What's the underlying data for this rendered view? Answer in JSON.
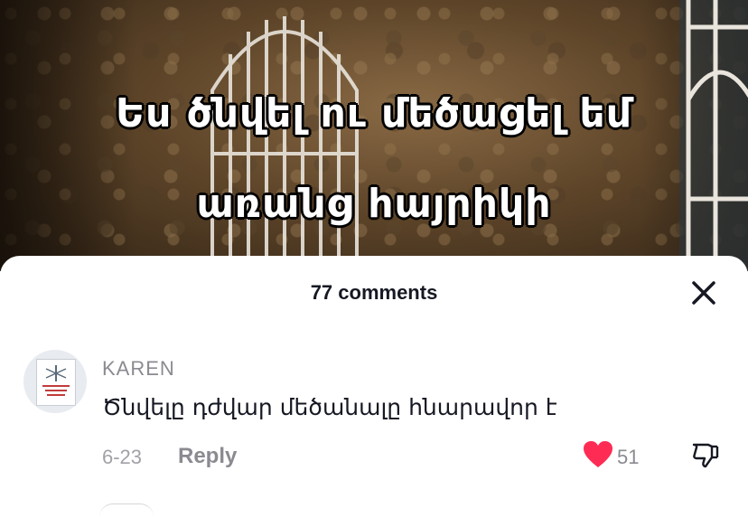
{
  "video": {
    "overlay_line1": "Ես ծնվել ու մեծացել եմ",
    "overlay_line2": "առանց հայրիկի"
  },
  "comments_panel": {
    "title": "77 comments",
    "close_icon": "close-icon",
    "comments": [
      {
        "username": "KAREN",
        "text": "Ծնվելը դժվար մեծանալը հնարավոր է",
        "date": "6-23",
        "reply_label": "Reply",
        "like_count": "51",
        "liked": true,
        "like_color": "#fe2c55"
      }
    ]
  }
}
